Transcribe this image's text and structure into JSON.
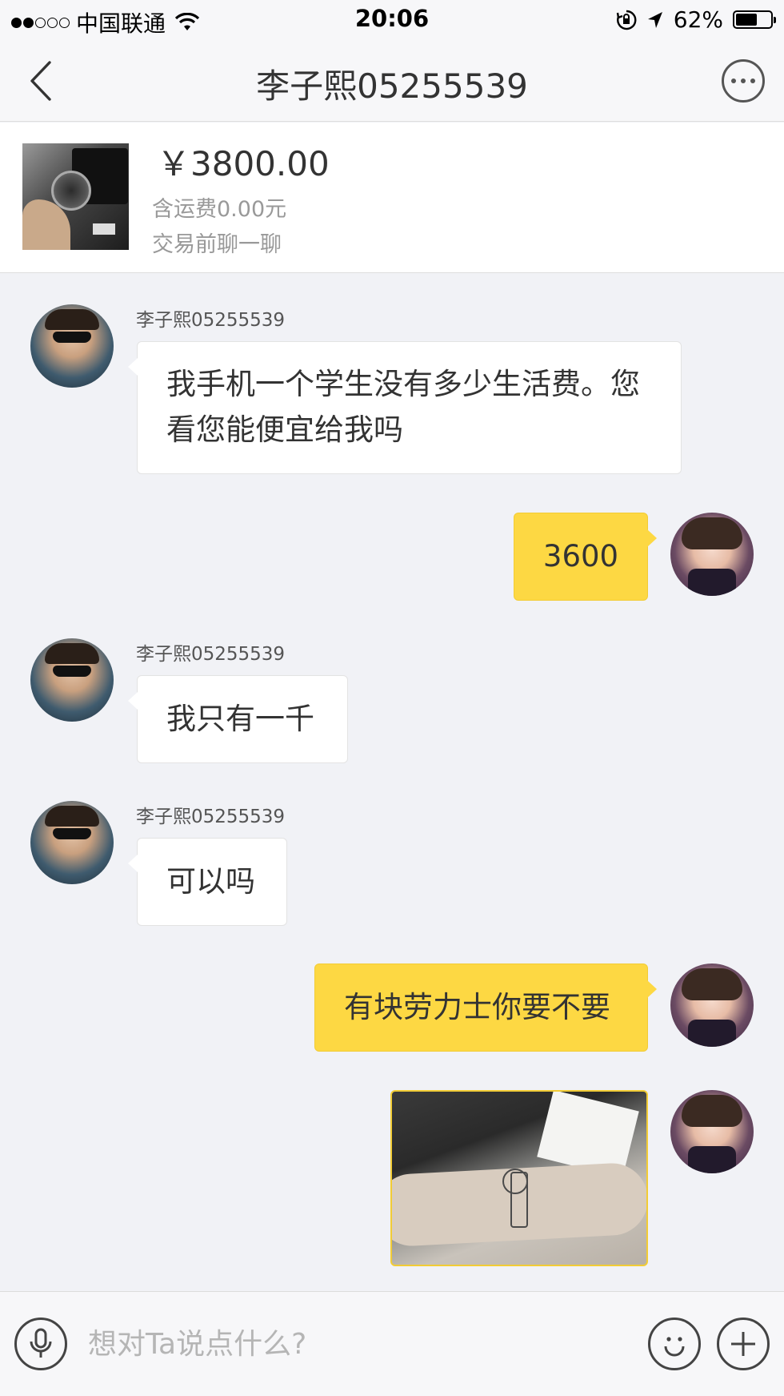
{
  "status_bar": {
    "carrier": "中国联通",
    "time": "20:06",
    "battery_percent": "62%",
    "battery_level": 0.62,
    "signal_bars_filled": 2,
    "signal_bars_total": 5
  },
  "nav": {
    "title": "李子熙05255539",
    "back_icon": "chevron-left-icon",
    "more_icon": "ellipsis-circle-icon"
  },
  "product": {
    "price": "￥3800.00",
    "shipping": "含运费0.00元",
    "chat_first": "交易前聊一聊"
  },
  "messages": [
    {
      "side": "left",
      "sender": "李子熙05255539",
      "text_line1": "我手机一个学生没有多少生活费。您",
      "text_line2": "看您能便宜给我吗"
    },
    {
      "side": "right",
      "text": "3600"
    },
    {
      "side": "left",
      "sender": "李子熙05255539",
      "text": "我只有一千"
    },
    {
      "side": "left",
      "sender": "李子熙05255539",
      "text": "可以吗"
    },
    {
      "side": "right",
      "text": "有块劳力士你要不要"
    },
    {
      "side": "right",
      "type": "image"
    }
  ],
  "input_bar": {
    "placeholder": "想对Ta说点什么?",
    "voice_icon": "microphone-icon",
    "emoji_icon": "smiley-icon",
    "plus_icon": "plus-icon"
  },
  "colors": {
    "accent_yellow": "#fdd843",
    "chat_background": "#f1f2f6",
    "bar_background": "#f7f7f9"
  }
}
